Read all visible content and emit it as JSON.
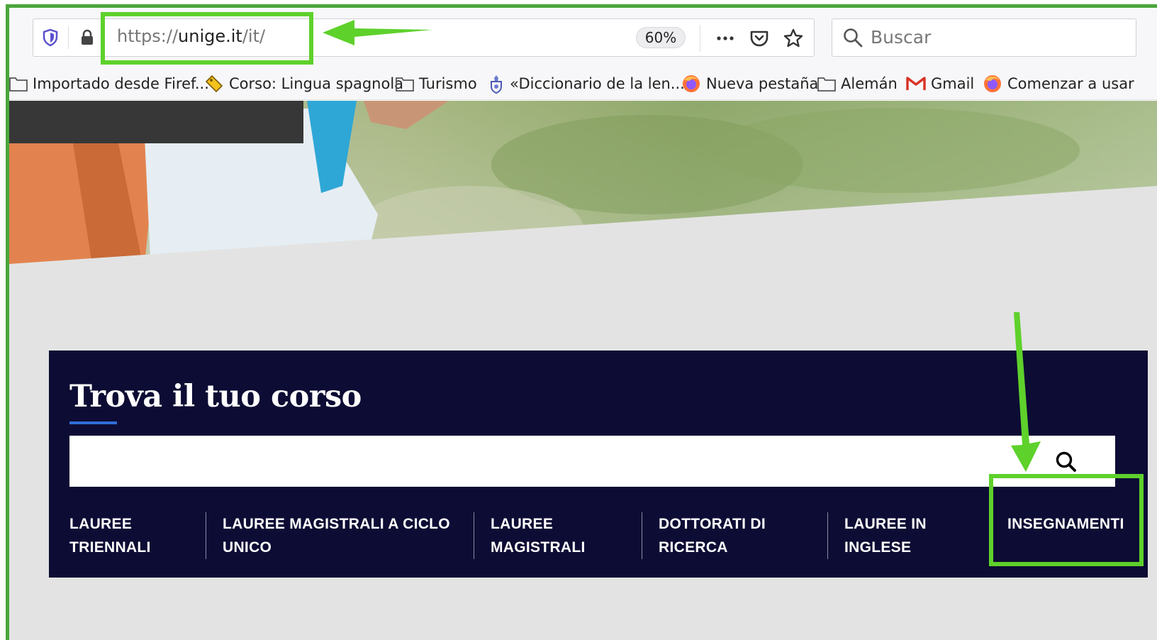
{
  "browser": {
    "url_prefix": "https://",
    "url_host": "unige.it",
    "url_path": "/it/",
    "zoom": "60%",
    "search_placeholder": "Buscar"
  },
  "bookmarks": [
    {
      "label": "Importado desde Firef...",
      "icon": "folder-icon"
    },
    {
      "label": "Corso: Lingua spagnola",
      "icon": "tag-icon"
    },
    {
      "label": "Turismo",
      "icon": "folder-icon"
    },
    {
      "label": "«Diccionario de la len...",
      "icon": "crest-icon"
    },
    {
      "label": "Nueva pestaña",
      "icon": "firefox-icon"
    },
    {
      "label": "Alemán",
      "icon": "folder-icon"
    },
    {
      "label": "Gmail",
      "icon": "gmail-icon"
    },
    {
      "label": "Comenzar a usar",
      "icon": "firefox-icon"
    }
  ],
  "finder": {
    "title": "Trova il tuo corso",
    "search_value": "",
    "categories": [
      {
        "line1": "LAUREE",
        "line2": "TRIENNALI"
      },
      {
        "line1": "LAUREE MAGISTRALI A CICLO",
        "line2": "UNICO"
      },
      {
        "line1": "LAUREE",
        "line2": "MAGISTRALI"
      },
      {
        "line1": "DOTTORATI DI",
        "line2": "RICERCA"
      },
      {
        "line1": "LAUREE IN",
        "line2": "INGLESE"
      },
      {
        "line1": "INSEGNAMENTI",
        "line2": ""
      }
    ]
  },
  "colors": {
    "panel_bg": "#0d0c34",
    "annotation_green": "#5ed12b",
    "frame_green": "#4aa63a",
    "title_underline": "#2f6fd6"
  }
}
